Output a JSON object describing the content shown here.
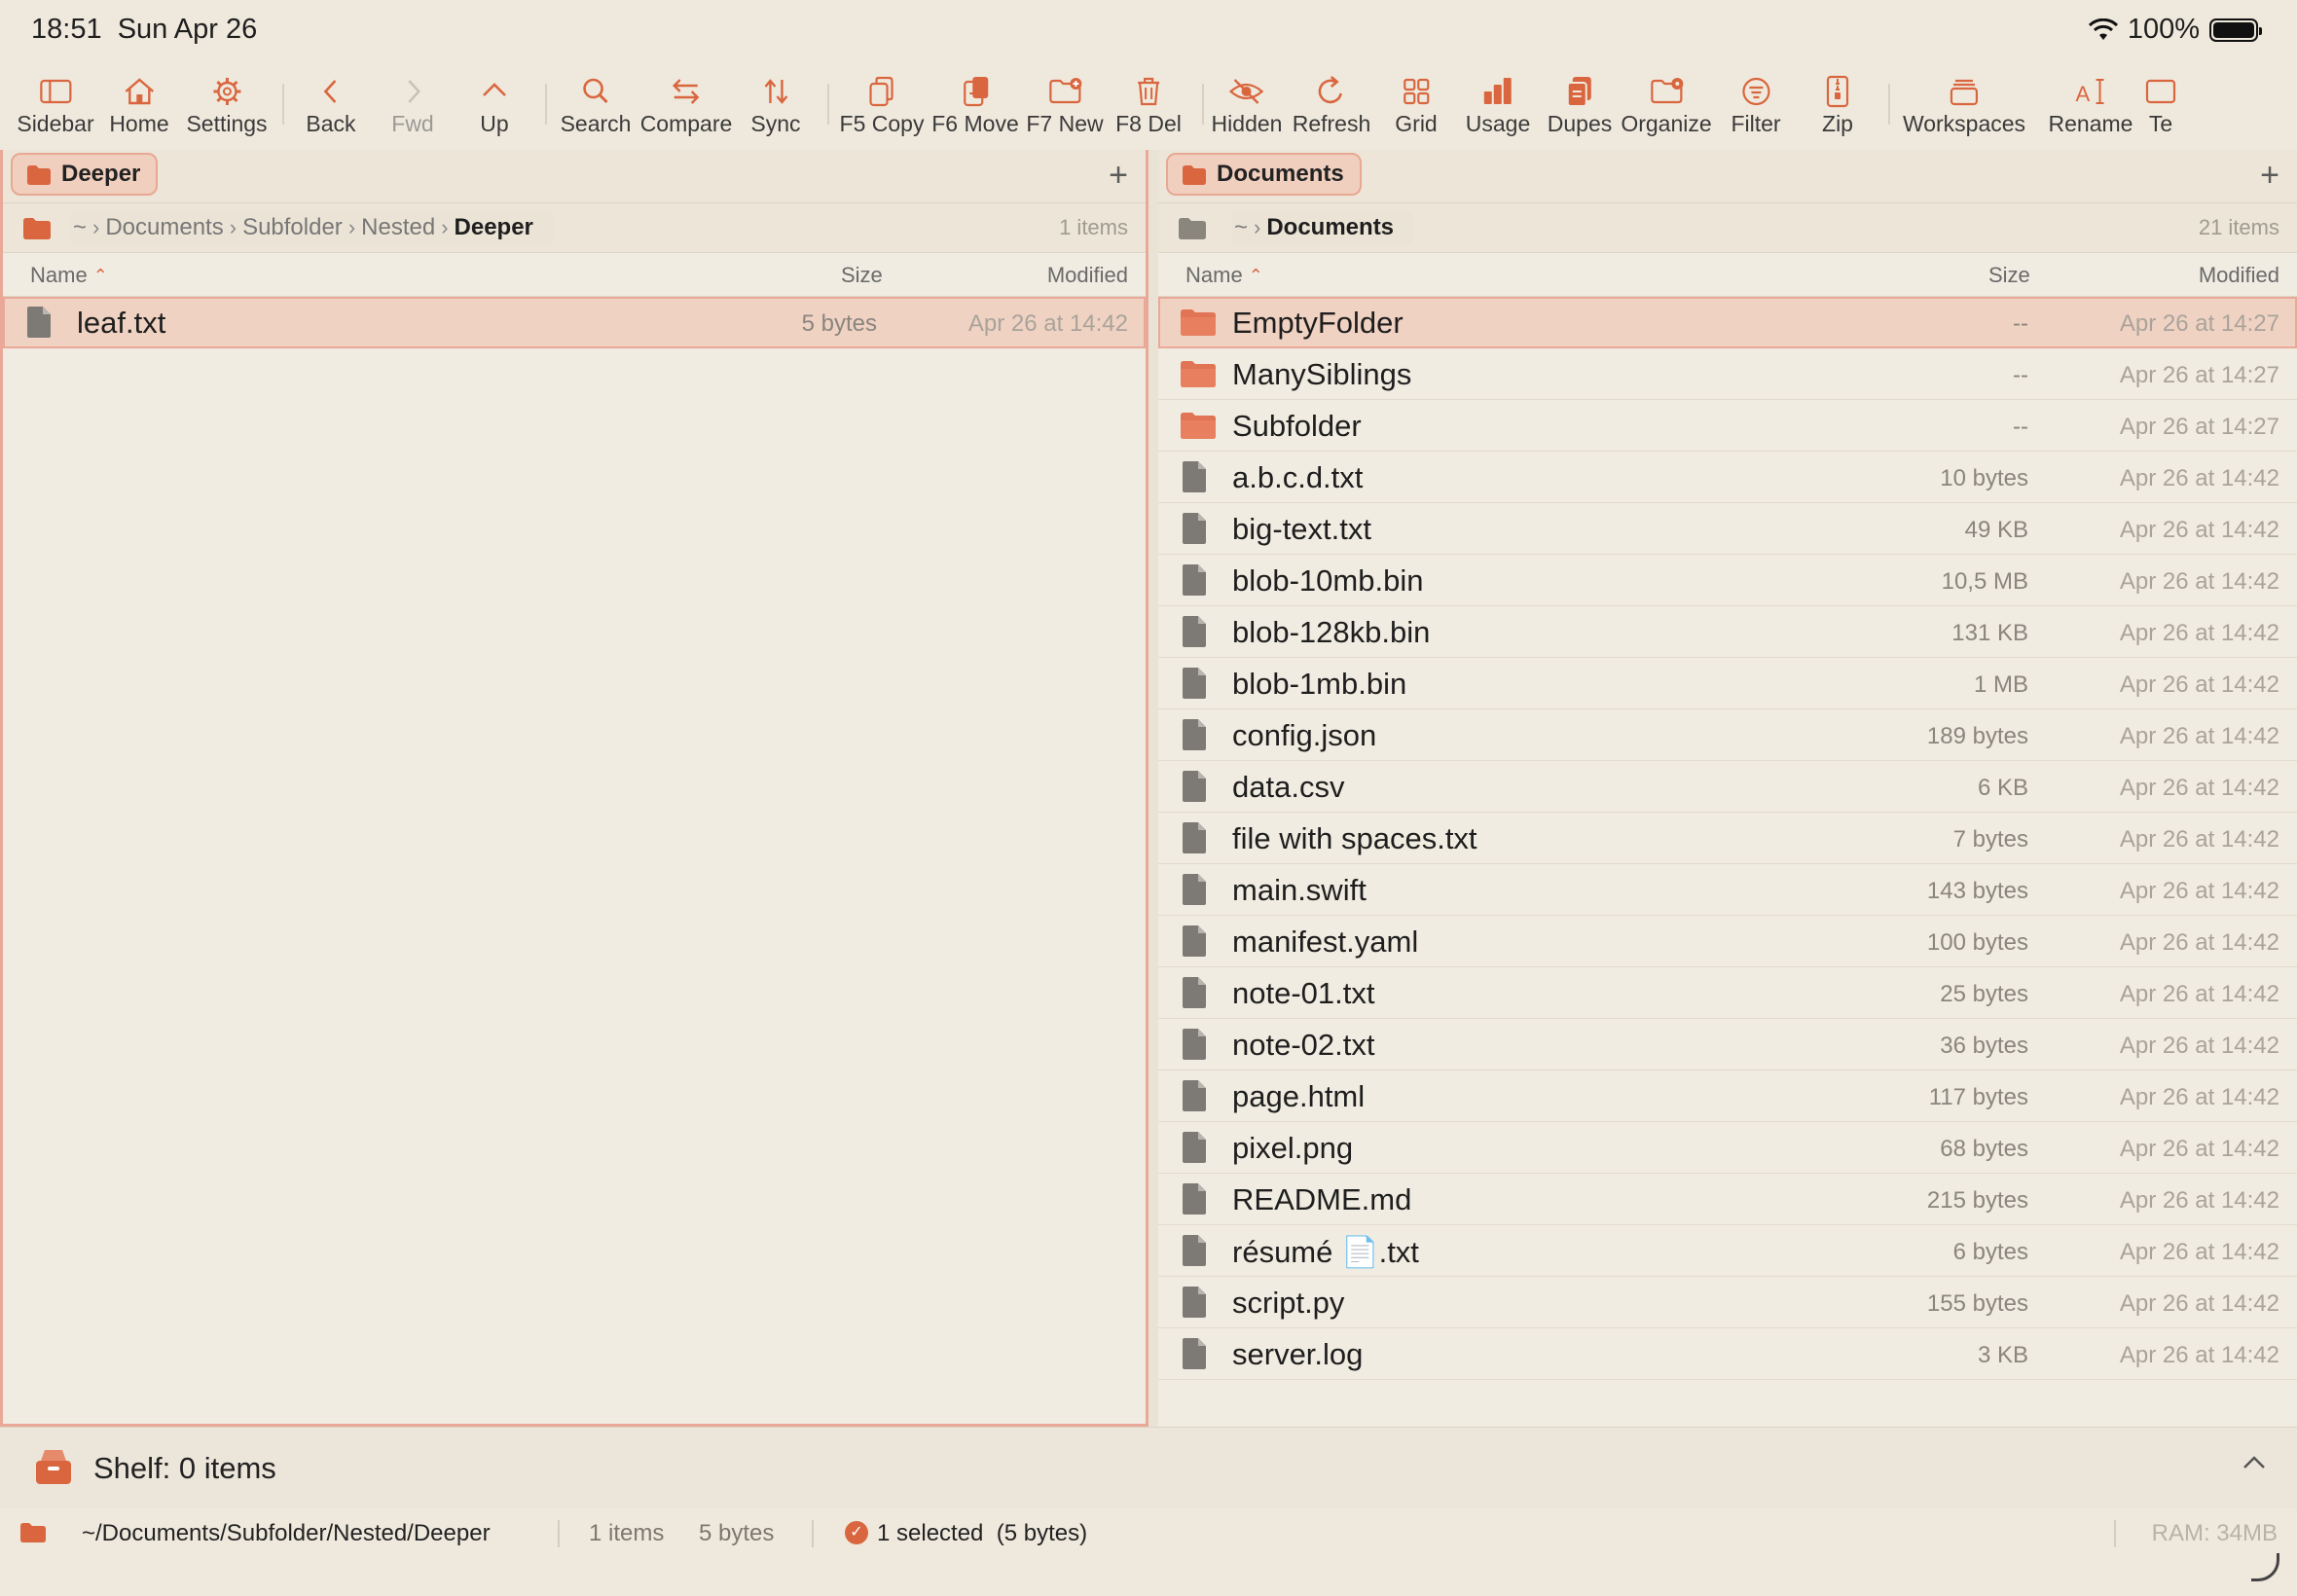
{
  "status": {
    "time": "18:51",
    "date": "Sun Apr 26",
    "battery": "100%"
  },
  "toolbar": [
    {
      "label": "Sidebar",
      "icon": "sidebar-icon"
    },
    {
      "label": "Home",
      "icon": "home-icon"
    },
    {
      "label": "Settings",
      "icon": "gear-icon"
    },
    {
      "label": "Back",
      "icon": "chevron-left-icon"
    },
    {
      "label": "Fwd",
      "icon": "chevron-right-icon"
    },
    {
      "label": "Up",
      "icon": "chevron-up-icon"
    },
    {
      "label": "Search",
      "icon": "search-icon"
    },
    {
      "label": "Compare",
      "icon": "compare-arrows-icon"
    },
    {
      "label": "Sync",
      "icon": "sync-icon"
    },
    {
      "label": "F5 Copy",
      "icon": "copy-icon"
    },
    {
      "label": "F6 Move",
      "icon": "move-icon"
    },
    {
      "label": "F7 New",
      "icon": "new-folder-icon"
    },
    {
      "label": "F8 Del",
      "icon": "trash-icon"
    },
    {
      "label": "Hidden",
      "icon": "eye-slash-icon"
    },
    {
      "label": "Refresh",
      "icon": "refresh-icon"
    },
    {
      "label": "Grid",
      "icon": "grid-icon"
    },
    {
      "label": "Usage",
      "icon": "bar-chart-icon"
    },
    {
      "label": "Dupes",
      "icon": "duplicate-icon"
    },
    {
      "label": "Organize",
      "icon": "organize-folder-icon"
    },
    {
      "label": "Filter",
      "icon": "filter-icon"
    },
    {
      "label": "Zip",
      "icon": "zip-icon"
    },
    {
      "label": "Workspaces",
      "icon": "stack-icon"
    },
    {
      "label": "Rename",
      "icon": "rename-icon"
    },
    {
      "label": "Te",
      "icon": "terminal-icon"
    }
  ],
  "left_pane": {
    "tab": "Deeper",
    "add_tab": "+",
    "breadcrumb": [
      "~",
      "Documents",
      "Subfolder",
      "Nested",
      "Deeper"
    ],
    "count": "1 items",
    "columns": {
      "name": "Name",
      "size": "Size",
      "modified": "Modified"
    },
    "rows": [
      {
        "name": "leaf.txt",
        "size": "5 bytes",
        "modified": "Apr 26 at 14:42",
        "kind": "file",
        "selected": true
      }
    ]
  },
  "right_pane": {
    "tab": "Documents",
    "add_tab": "+",
    "breadcrumb": [
      "~",
      "Documents"
    ],
    "count": "21 items",
    "columns": {
      "name": "Name",
      "size": "Size",
      "modified": "Modified"
    },
    "rows": [
      {
        "name": "EmptyFolder",
        "size": "--",
        "modified": "Apr 26 at 14:27",
        "kind": "folder",
        "selected": true
      },
      {
        "name": "ManySiblings",
        "size": "--",
        "modified": "Apr 26 at 14:27",
        "kind": "folder"
      },
      {
        "name": "Subfolder",
        "size": "--",
        "modified": "Apr 26 at 14:27",
        "kind": "folder"
      },
      {
        "name": "a.b.c.d.txt",
        "size": "10 bytes",
        "modified": "Apr 26 at 14:42",
        "kind": "file"
      },
      {
        "name": "big-text.txt",
        "size": "49 KB",
        "modified": "Apr 26 at 14:42",
        "kind": "file"
      },
      {
        "name": "blob-10mb.bin",
        "size": "10,5 MB",
        "modified": "Apr 26 at 14:42",
        "kind": "file"
      },
      {
        "name": "blob-128kb.bin",
        "size": "131 KB",
        "modified": "Apr 26 at 14:42",
        "kind": "file"
      },
      {
        "name": "blob-1mb.bin",
        "size": "1 MB",
        "modified": "Apr 26 at 14:42",
        "kind": "file"
      },
      {
        "name": "config.json",
        "size": "189 bytes",
        "modified": "Apr 26 at 14:42",
        "kind": "file"
      },
      {
        "name": "data.csv",
        "size": "6 KB",
        "modified": "Apr 26 at 14:42",
        "kind": "file"
      },
      {
        "name": "file with spaces.txt",
        "size": "7 bytes",
        "modified": "Apr 26 at 14:42",
        "kind": "file"
      },
      {
        "name": "main.swift",
        "size": "143 bytes",
        "modified": "Apr 26 at 14:42",
        "kind": "file"
      },
      {
        "name": "manifest.yaml",
        "size": "100 bytes",
        "modified": "Apr 26 at 14:42",
        "kind": "file"
      },
      {
        "name": "note-01.txt",
        "size": "25 bytes",
        "modified": "Apr 26 at 14:42",
        "kind": "file"
      },
      {
        "name": "note-02.txt",
        "size": "36 bytes",
        "modified": "Apr 26 at 14:42",
        "kind": "file"
      },
      {
        "name": "page.html",
        "size": "117 bytes",
        "modified": "Apr 26 at 14:42",
        "kind": "file"
      },
      {
        "name": "pixel.png",
        "size": "68 bytes",
        "modified": "Apr 26 at 14:42",
        "kind": "file"
      },
      {
        "name": "README.md",
        "size": "215 bytes",
        "modified": "Apr 26 at 14:42",
        "kind": "file"
      },
      {
        "name": "résumé 📄.txt",
        "size": "6 bytes",
        "modified": "Apr 26 at 14:42",
        "kind": "file"
      },
      {
        "name": "script.py",
        "size": "155 bytes",
        "modified": "Apr 26 at 14:42",
        "kind": "file"
      },
      {
        "name": "server.log",
        "size": "3 KB",
        "modified": "Apr 26 at 14:42",
        "kind": "file"
      }
    ]
  },
  "shelf": {
    "label": "Shelf: 0 items"
  },
  "bottom": {
    "path": "~/Documents/Subfolder/Nested/Deeper",
    "items": "1 items",
    "bytes": "5 bytes",
    "selected": "1 selected  (5 bytes)",
    "ram": "RAM: 34MB"
  },
  "colors": {
    "accent": "#d9663f",
    "selection": "#f0d2c3",
    "background": "#efe9dd"
  }
}
